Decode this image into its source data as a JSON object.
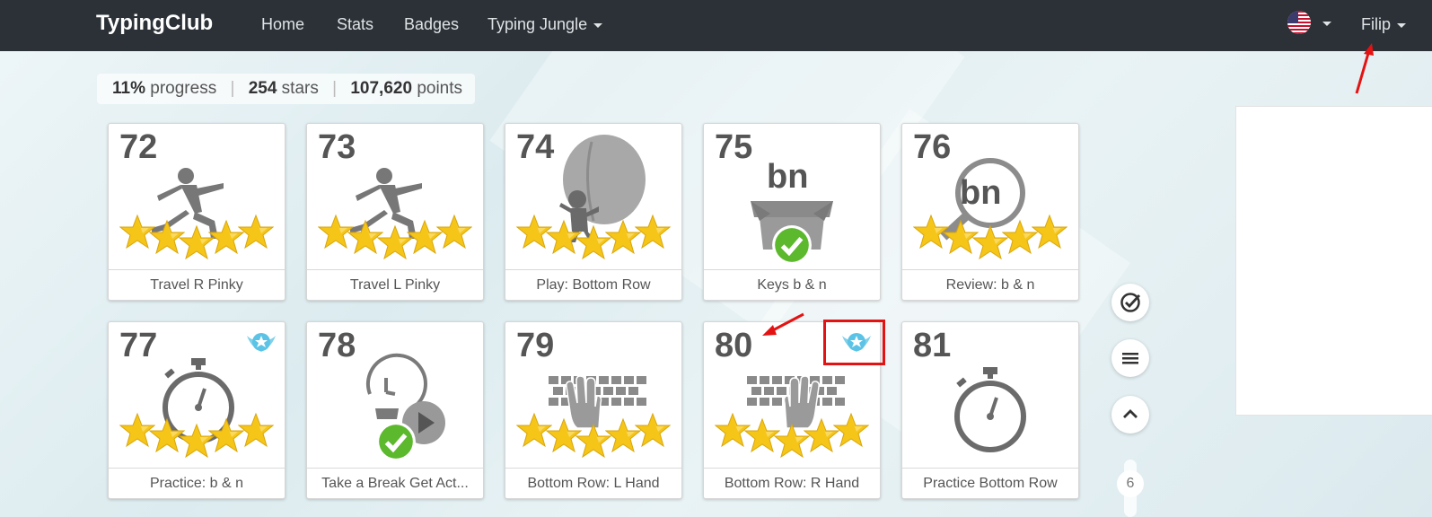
{
  "navbar": {
    "brand": "TypingClub",
    "items": [
      {
        "label": "Home"
      },
      {
        "label": "Stats"
      },
      {
        "label": "Badges"
      },
      {
        "label": "Typing Jungle"
      }
    ],
    "user": "Filip"
  },
  "progress": {
    "percent": "11%",
    "percent_label": "progress",
    "stars": "254",
    "stars_label": "stars",
    "points": "107,620",
    "points_label": "points"
  },
  "lessons": [
    {
      "number": "72",
      "label": "Travel R Pinky",
      "stars": 5,
      "icon": "lunge-figure-icon"
    },
    {
      "number": "73",
      "label": "Travel L Pinky",
      "stars": 5,
      "icon": "lunge-figure-icon"
    },
    {
      "number": "74",
      "label": "Play: Bottom Row",
      "stars": 5,
      "icon": "balloon-game-icon"
    },
    {
      "number": "75",
      "label": "Keys b & n",
      "stars": 0,
      "icon": "key-box-icon",
      "letters": "bn",
      "completed": true
    },
    {
      "number": "76",
      "label": "Review: b & n",
      "stars": 5,
      "icon": "magnifier-icon",
      "letters": "bn"
    },
    {
      "number": "77",
      "label": "Practice: b & n",
      "stars": 5,
      "icon": "stopwatch-icon",
      "badge": true
    },
    {
      "number": "78",
      "label": "Take a Break Get Act...",
      "stars": 0,
      "icon": "break-video-icon",
      "completed": true
    },
    {
      "number": "79",
      "label": "Bottom Row: L Hand",
      "stars": 5,
      "icon": "keyboard-hand-icon"
    },
    {
      "number": "80",
      "label": "Bottom Row: R Hand",
      "stars": 5,
      "icon": "keyboard-hand-icon",
      "badge": true
    },
    {
      "number": "81",
      "label": "Practice Bottom Row",
      "stars": 0,
      "icon": "stopwatch-icon"
    }
  ],
  "side": {
    "page": "6"
  },
  "colors": {
    "navbar": "#2b3137",
    "star": "#f5c518",
    "check": "#5cb82c",
    "annotation": "#e41313"
  }
}
